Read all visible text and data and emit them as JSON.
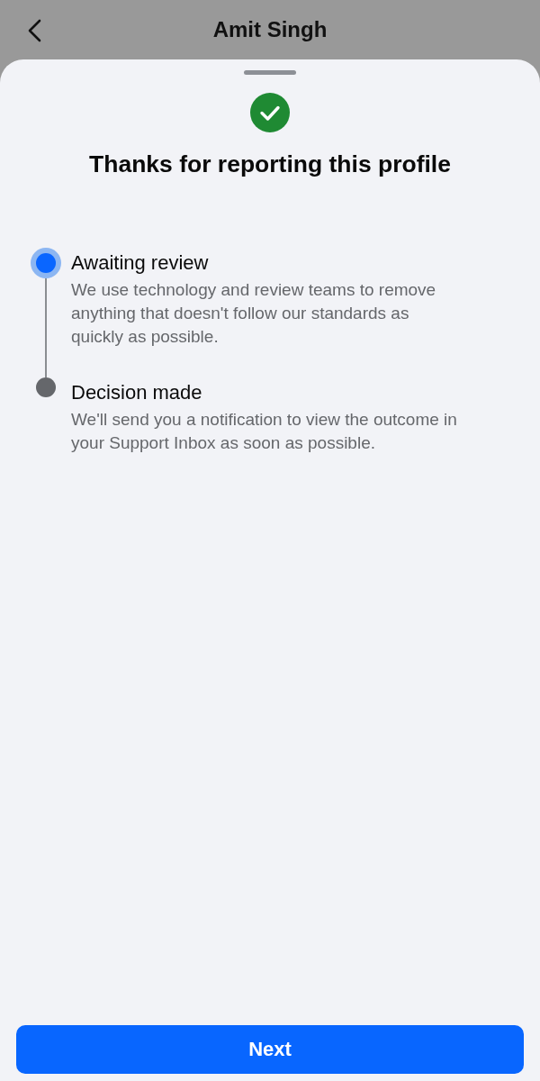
{
  "header": {
    "title": "Amit Singh"
  },
  "sheet": {
    "title": "Thanks for reporting this profile"
  },
  "steps": [
    {
      "title": "Awaiting review",
      "description": "We use technology and review teams to remove anything that doesn't follow our standards as quickly as possible.",
      "current": true
    },
    {
      "title": "Decision made",
      "description": "We'll send you a notification to view the outcome in your Support Inbox as soon as possible.",
      "current": false
    }
  ],
  "button": {
    "label": "Next"
  }
}
